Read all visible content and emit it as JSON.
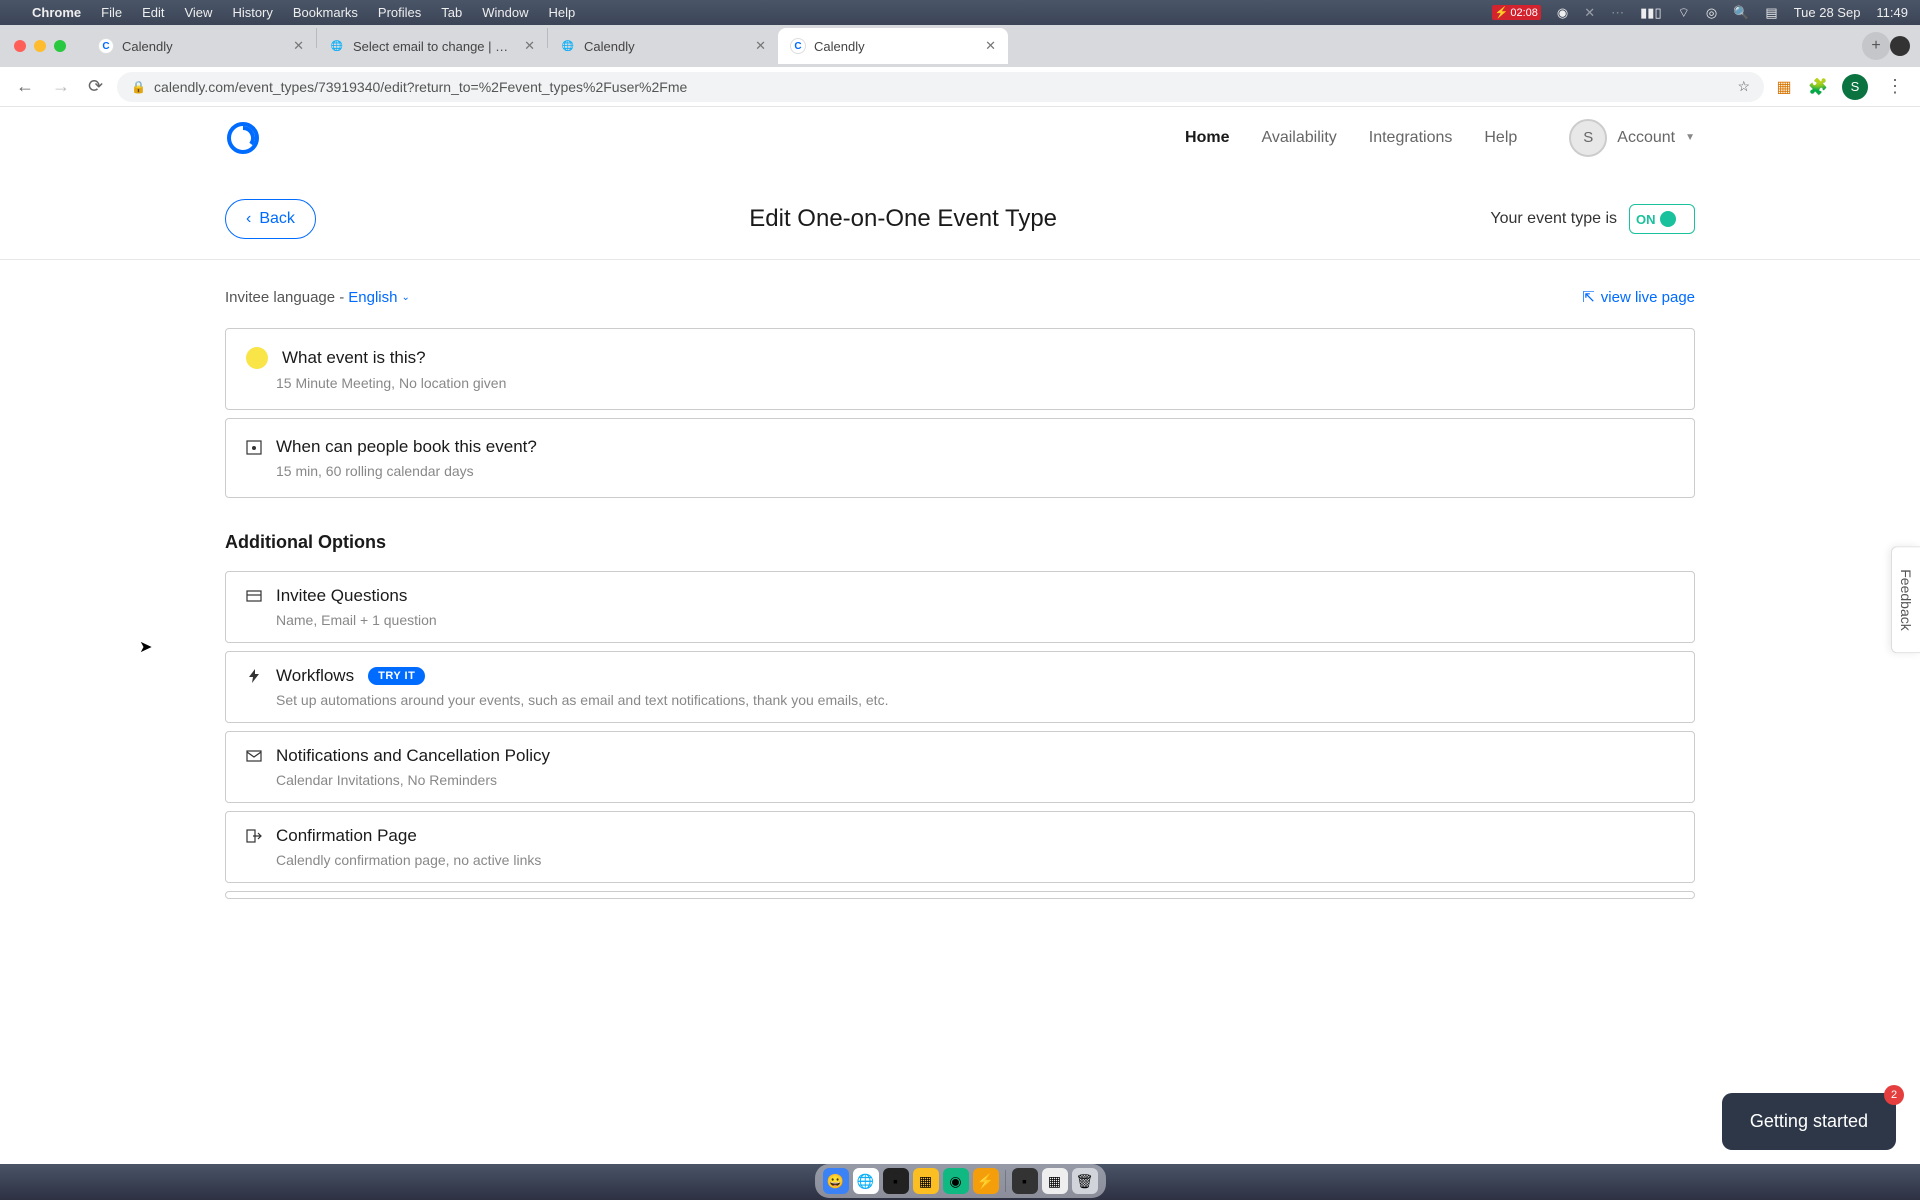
{
  "menubar": {
    "app": "Chrome",
    "items": [
      "File",
      "Edit",
      "View",
      "History",
      "Bookmarks",
      "Profiles",
      "Tab",
      "Window",
      "Help"
    ],
    "battery_time": "02:08",
    "date": "Tue 28 Sep",
    "time": "11:49"
  },
  "browser": {
    "tabs": [
      {
        "title": "Calendly",
        "favicon": "calendly"
      },
      {
        "title": "Select email to change | Djang",
        "favicon": "django"
      },
      {
        "title": "Calendly",
        "favicon": "calendly"
      },
      {
        "title": "Calendly",
        "favicon": "calendly",
        "active": true
      }
    ],
    "url": "calendly.com/event_types/73919340/edit?return_to=%2Fevent_types%2Fuser%2Fme",
    "avatar_initial": "S"
  },
  "nav": {
    "items": [
      "Home",
      "Availability",
      "Integrations",
      "Help"
    ],
    "account_label": "Account",
    "avatar_initial": "S"
  },
  "subheader": {
    "back_label": "Back",
    "title": "Edit One-on-One Event Type",
    "toggle_text": "Your event type is",
    "toggle_state": "ON"
  },
  "content": {
    "lang_prefix": "Invitee language - ",
    "lang_value": "English",
    "view_live": "view live page",
    "cards_main": [
      {
        "title": "What event is this?",
        "sub": "15 Minute Meeting, No location given"
      },
      {
        "title": "When can people book this event?",
        "sub": "15 min, 60 rolling calendar days"
      }
    ],
    "additional_title": "Additional Options",
    "cards_additional": [
      {
        "title": "Invitee Questions",
        "sub": "Name, Email + 1 question"
      },
      {
        "title": "Workflows",
        "badge": "TRY IT",
        "sub": "Set up automations around your events, such as email and text notifications, thank you emails, etc."
      },
      {
        "title": "Notifications and Cancellation Policy",
        "sub": "Calendar Invitations, No Reminders"
      },
      {
        "title": "Confirmation Page",
        "sub": "Calendly confirmation page, no active links"
      }
    ]
  },
  "feedback_label": "Feedback",
  "getting_started": {
    "label": "Getting started",
    "count": "2"
  }
}
